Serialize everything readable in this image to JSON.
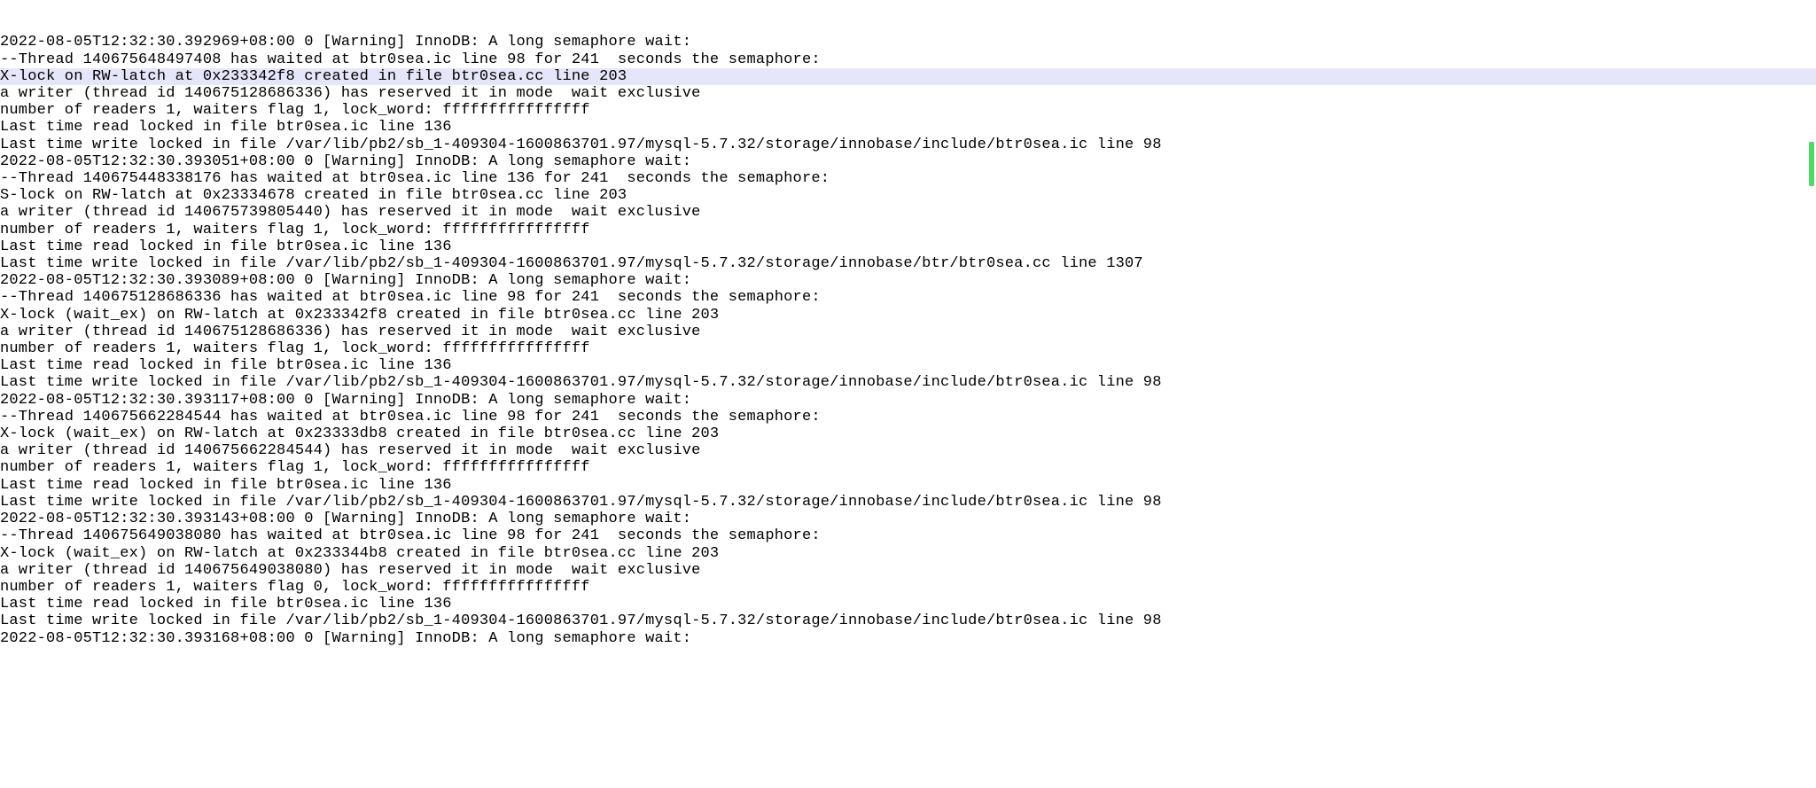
{
  "log": {
    "lines": [
      {
        "text": "2022-08-05T12:32:30.392969+08:00 0 [Warning] InnoDB: A long semaphore wait:",
        "highlighted": false
      },
      {
        "text": "--Thread 140675648497408 has waited at btr0sea.ic line 98 for 241  seconds the semaphore:",
        "highlighted": false
      },
      {
        "text": "X-lock on RW-latch at 0x233342f8 created in file btr0sea.cc line 203",
        "highlighted": true
      },
      {
        "text": "a writer (thread id 140675128686336) has reserved it in mode  wait exclusive",
        "highlighted": false
      },
      {
        "text": "number of readers 1, waiters flag 1, lock_word: ffffffffffffffff",
        "highlighted": false
      },
      {
        "text": "Last time read locked in file btr0sea.ic line 136",
        "highlighted": false
      },
      {
        "text": "Last time write locked in file /var/lib/pb2/sb_1-409304-1600863701.97/mysql-5.7.32/storage/innobase/include/btr0sea.ic line 98",
        "highlighted": false
      },
      {
        "text": "2022-08-05T12:32:30.393051+08:00 0 [Warning] InnoDB: A long semaphore wait:",
        "highlighted": false
      },
      {
        "text": "--Thread 140675448338176 has waited at btr0sea.ic line 136 for 241  seconds the semaphore:",
        "highlighted": false
      },
      {
        "text": "S-lock on RW-latch at 0x23334678 created in file btr0sea.cc line 203",
        "highlighted": false
      },
      {
        "text": "a writer (thread id 140675739805440) has reserved it in mode  wait exclusive",
        "highlighted": false
      },
      {
        "text": "number of readers 1, waiters flag 1, lock_word: ffffffffffffffff",
        "highlighted": false
      },
      {
        "text": "Last time read locked in file btr0sea.ic line 136",
        "highlighted": false
      },
      {
        "text": "Last time write locked in file /var/lib/pb2/sb_1-409304-1600863701.97/mysql-5.7.32/storage/innobase/btr/btr0sea.cc line 1307",
        "highlighted": false
      },
      {
        "text": "2022-08-05T12:32:30.393089+08:00 0 [Warning] InnoDB: A long semaphore wait:",
        "highlighted": false
      },
      {
        "text": "--Thread 140675128686336 has waited at btr0sea.ic line 98 for 241  seconds the semaphore:",
        "highlighted": false
      },
      {
        "text": "X-lock (wait_ex) on RW-latch at 0x233342f8 created in file btr0sea.cc line 203",
        "highlighted": false
      },
      {
        "text": "a writer (thread id 140675128686336) has reserved it in mode  wait exclusive",
        "highlighted": false
      },
      {
        "text": "number of readers 1, waiters flag 1, lock_word: ffffffffffffffff",
        "highlighted": false
      },
      {
        "text": "Last time read locked in file btr0sea.ic line 136",
        "highlighted": false
      },
      {
        "text": "Last time write locked in file /var/lib/pb2/sb_1-409304-1600863701.97/mysql-5.7.32/storage/innobase/include/btr0sea.ic line 98",
        "highlighted": false
      },
      {
        "text": "2022-08-05T12:32:30.393117+08:00 0 [Warning] InnoDB: A long semaphore wait:",
        "highlighted": false
      },
      {
        "text": "--Thread 140675662284544 has waited at btr0sea.ic line 98 for 241  seconds the semaphore:",
        "highlighted": false
      },
      {
        "text": "X-lock (wait_ex) on RW-latch at 0x23333db8 created in file btr0sea.cc line 203",
        "highlighted": false
      },
      {
        "text": "a writer (thread id 140675662284544) has reserved it in mode  wait exclusive",
        "highlighted": false
      },
      {
        "text": "number of readers 1, waiters flag 1, lock_word: ffffffffffffffff",
        "highlighted": false
      },
      {
        "text": "Last time read locked in file btr0sea.ic line 136",
        "highlighted": false
      },
      {
        "text": "Last time write locked in file /var/lib/pb2/sb_1-409304-1600863701.97/mysql-5.7.32/storage/innobase/include/btr0sea.ic line 98",
        "highlighted": false
      },
      {
        "text": "2022-08-05T12:32:30.393143+08:00 0 [Warning] InnoDB: A long semaphore wait:",
        "highlighted": false
      },
      {
        "text": "--Thread 140675649038080 has waited at btr0sea.ic line 98 for 241  seconds the semaphore:",
        "highlighted": false
      },
      {
        "text": "X-lock (wait_ex) on RW-latch at 0x233344b8 created in file btr0sea.cc line 203",
        "highlighted": false
      },
      {
        "text": "a writer (thread id 140675649038080) has reserved it in mode  wait exclusive",
        "highlighted": false
      },
      {
        "text": "number of readers 1, waiters flag 0, lock_word: ffffffffffffffff",
        "highlighted": false
      },
      {
        "text": "Last time read locked in file btr0sea.ic line 136",
        "highlighted": false
      },
      {
        "text": "Last time write locked in file /var/lib/pb2/sb_1-409304-1600863701.97/mysql-5.7.32/storage/innobase/include/btr0sea.ic line 98",
        "highlighted": false
      },
      {
        "text": "2022-08-05T12:32:30.393168+08:00 0 [Warning] InnoDB: A long semaphore wait:",
        "highlighted": false
      }
    ]
  }
}
